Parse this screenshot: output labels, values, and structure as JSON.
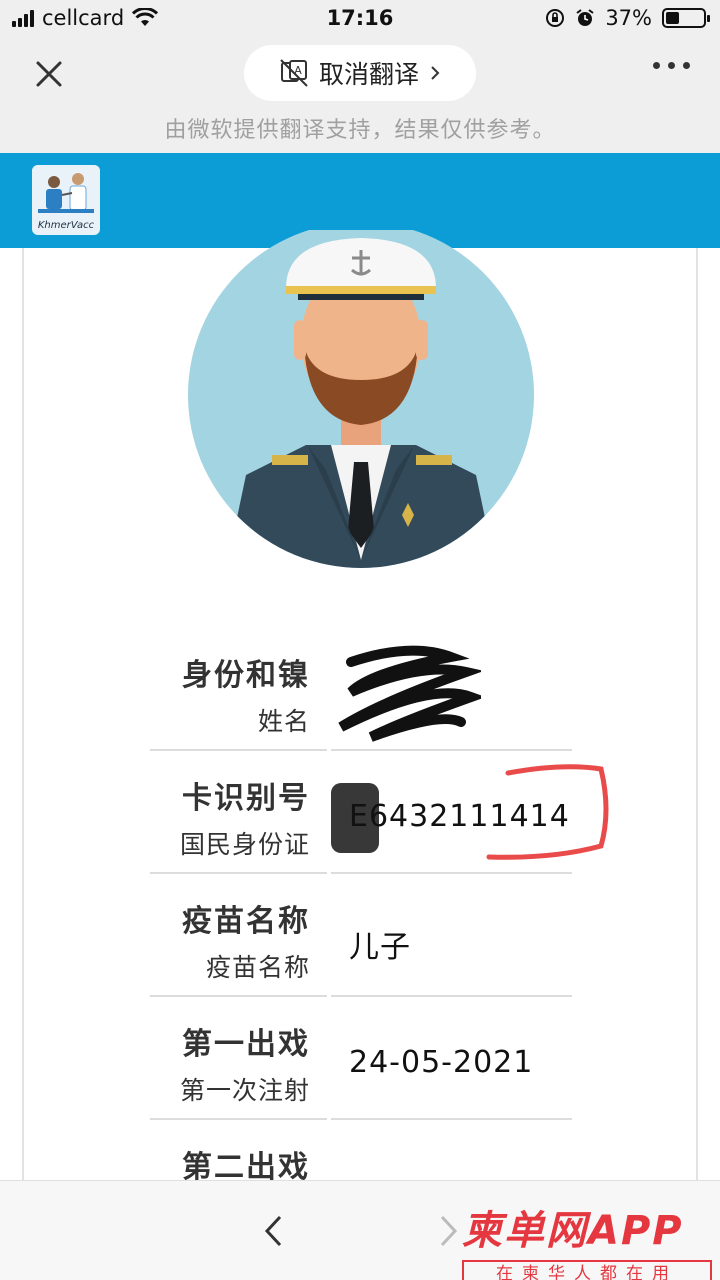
{
  "status_bar": {
    "carrier": "cellcard",
    "time": "17:16",
    "battery": "37%",
    "battery_level": 0.37
  },
  "header": {
    "translate_toggle": "取消翻译",
    "translation_notice": "由微软提供翻译支持，结果仅供参考。"
  },
  "app": {
    "logo_text": "KhmerVacc",
    "brand_color": "#0c9dd6"
  },
  "fields": [
    {
      "label": "身份和镍",
      "sublabel": "姓名",
      "value": ""
    },
    {
      "label": "卡识别号",
      "sublabel": "国民身份证",
      "value": "E6432111414"
    },
    {
      "label": "疫苗名称",
      "sublabel": "疫苗名称",
      "value": "儿子"
    },
    {
      "label": "第一出戏",
      "sublabel": "第一次注射",
      "value": "24-05-2021"
    },
    {
      "label": "第二出戏",
      "sublabel": "",
      "value": ""
    }
  ],
  "watermark": {
    "title": "柬单网APP",
    "subtitle": "在柬华人都在用",
    "color": "#e5373f"
  }
}
